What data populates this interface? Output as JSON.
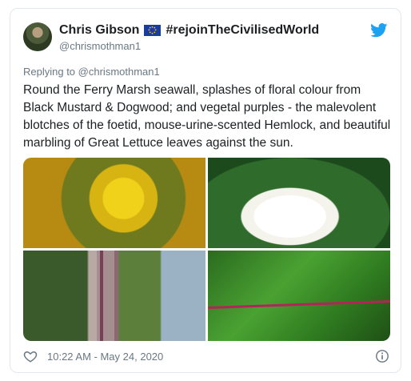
{
  "tweet": {
    "display_name": "Chris Gibson",
    "hashtag": "#rejoinTheCivilisedWorld",
    "handle": "@chrismothman1",
    "reply_prefix": "Replying to",
    "reply_to": "@chrismothman1",
    "text": "Round the Ferry Marsh seawall, splashes of floral colour from Black Mustard & Dogwood; and vegetal purples - the malevolent blotches of the foetid, mouse-urine-scented Hemlock, and beautiful marbling of Great Lettuce leaves against the sun.",
    "timestamp": "10:22 AM - May 24, 2020"
  },
  "icons": {
    "flag": "eu-flag-icon",
    "brand": "twitter-bird-icon",
    "like": "heart-icon",
    "info": "info-icon"
  },
  "colors": {
    "twitter_blue": "#1da1f2",
    "secondary_text": "#697882",
    "primary_text": "#1c2022"
  }
}
